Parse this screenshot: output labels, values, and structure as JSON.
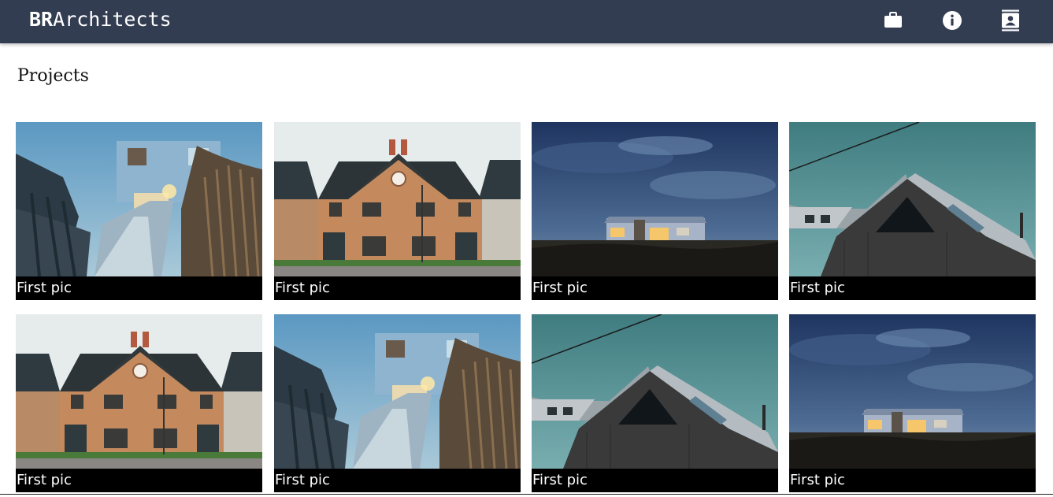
{
  "header": {
    "brand_bold": "BR",
    "brand_rest": "Architects",
    "icons": [
      "briefcase-icon",
      "info-icon",
      "contact-book-icon"
    ],
    "background_color": "#333d52"
  },
  "main": {
    "title": "Projects"
  },
  "projects": [
    {
      "caption": "First pic",
      "image": "wooden-walkway-house"
    },
    {
      "caption": "First pic",
      "image": "brick-house"
    },
    {
      "caption": "First pic",
      "image": "night-bungalow"
    },
    {
      "caption": "First pic",
      "image": "dark-gable-house"
    },
    {
      "caption": "First pic",
      "image": "brick-house"
    },
    {
      "caption": "First pic",
      "image": "wooden-walkway-house"
    },
    {
      "caption": "First pic",
      "image": "dark-gable-house"
    },
    {
      "caption": "First pic",
      "image": "night-bungalow"
    }
  ]
}
